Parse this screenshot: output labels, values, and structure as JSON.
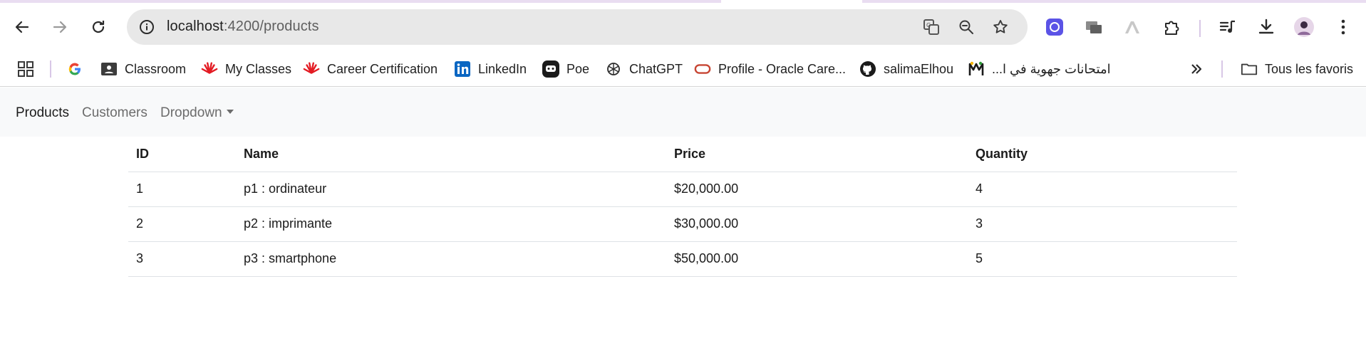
{
  "browser": {
    "url_host": "localhost",
    "url_path": ":4200/products",
    "buttons": {
      "back": "back-icon",
      "forward": "forward-icon",
      "reload": "reload-icon",
      "site_info": "info-icon",
      "translate": "translate-icon",
      "zoom": "zoom-icon",
      "bookmark": "star-icon",
      "extensions": "puzzle-icon",
      "media": "media-icon",
      "downloads": "download-icon",
      "menu": "kebab-icon"
    }
  },
  "bookmarks": {
    "items": [
      {
        "label": "Classroom",
        "icon": "classroom-icon"
      },
      {
        "label": "My Classes",
        "icon": "huawei-icon"
      },
      {
        "label": "Career Certification",
        "icon": "huawei-icon"
      },
      {
        "label": "LinkedIn",
        "icon": "linkedin-icon"
      },
      {
        "label": "Poe",
        "icon": "poe-icon"
      },
      {
        "label": "ChatGPT",
        "icon": "chatgpt-icon"
      },
      {
        "label": "Profile - Oracle Care...",
        "icon": "oracle-icon"
      },
      {
        "label": "salimaElhou",
        "icon": "github-icon"
      },
      {
        "label": "امتحانات جهوية في ا...",
        "icon": "m-icon"
      }
    ],
    "all_bookmarks": "Tous les favoris"
  },
  "navbar": {
    "links": [
      "Products",
      "Customers",
      "Dropdown"
    ],
    "active": "Products"
  },
  "table": {
    "headers": [
      "ID",
      "Name",
      "Price",
      "Quantity"
    ],
    "rows": [
      [
        "1",
        "p1 : ordinateur",
        "$20,000.00",
        "4"
      ],
      [
        "2",
        "p2 : imprimante",
        "$30,000.00",
        "3"
      ],
      [
        "3",
        "p3 : smartphone",
        "$50,000.00",
        "5"
      ]
    ]
  },
  "colors": {
    "navbar_bg": "#f8f9fa",
    "omnibox_bg": "#e8e8e8",
    "border": "#dee2e6"
  }
}
